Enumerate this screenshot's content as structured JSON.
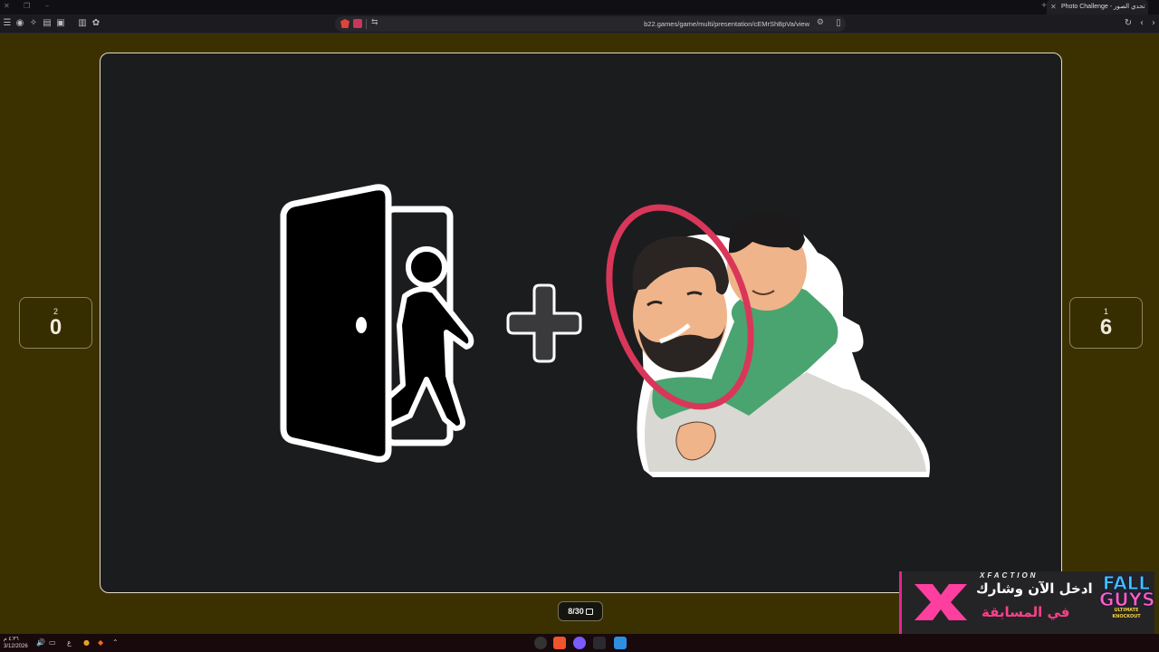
{
  "browser": {
    "tab_title": "Photo Challenge - تحدي الصور",
    "url": "b22.games/game/multi/presentation/cEMrShBpVa/view"
  },
  "scores": {
    "left": {
      "player": "2",
      "points": "0"
    },
    "right": {
      "player": "1",
      "points": "6"
    }
  },
  "slide_counter": "8/30",
  "puzzle": {
    "left_icon": "door-exit-icon",
    "operator": "plus-icon",
    "right_icon": "father-son-hug-icon"
  },
  "ad": {
    "brand": "XFACTION",
    "line1": "ادخل الآن وشارك",
    "line2": "في المسابقة",
    "game_title_1": "FALL",
    "game_title_2": "GUYS",
    "game_subtitle": "ULTIMATE KNOCKOUT"
  },
  "taskbar": {
    "time": "٤:٣٦ م",
    "date": "3/12/2026",
    "lang": "ع"
  },
  "colors": {
    "page_bg": "#3b3100",
    "stage_bg": "#1b1c1e",
    "circle_highlight": "#d9375a",
    "shirt_green": "#4aa470"
  }
}
